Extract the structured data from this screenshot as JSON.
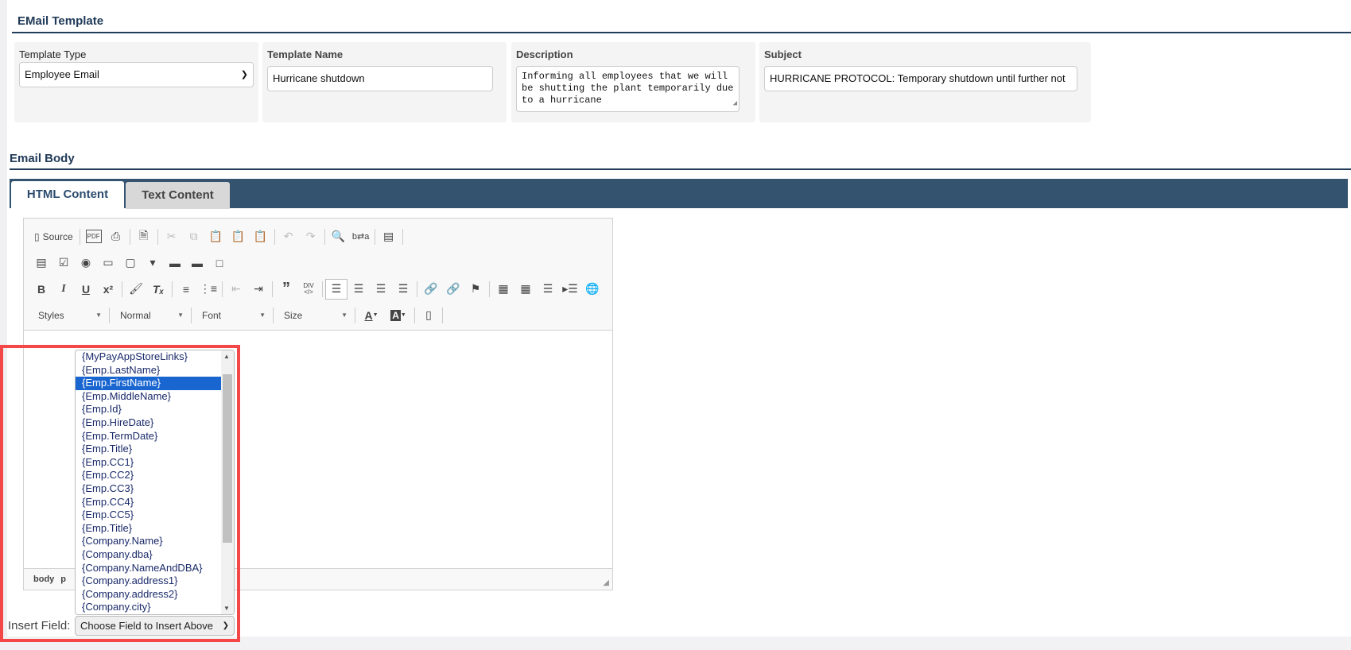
{
  "email_template": {
    "title": "EMail Template",
    "template_type": {
      "label": "Template Type",
      "value": "Employee Email"
    },
    "template_name": {
      "label": "Template Name",
      "value": "Hurricane shutdown"
    },
    "description": {
      "label": "Description",
      "value": "Informing all employees that we will be shutting the plant temporarily due to a hurricane"
    },
    "subject": {
      "label": "Subject",
      "value": "HURRICANE PROTOCOL: Temporary shutdown until further not"
    }
  },
  "email_body": {
    "title": "Email Body",
    "tabs": [
      {
        "label": "HTML Content"
      },
      {
        "label": "Text Content"
      }
    ]
  },
  "editor": {
    "source_label": "Source",
    "combos": {
      "styles": "Styles",
      "format": "Normal",
      "font": "Font",
      "size": "Size"
    },
    "path": [
      "body",
      "p"
    ]
  },
  "insert_field": {
    "label": "Insert Field:",
    "placeholder": "Choose Field to Insert Above",
    "selected": "{Emp.FirstName}",
    "options": [
      "{MyPayAppStoreLinks}",
      "{Emp.LastName}",
      "{Emp.FirstName}",
      "{Emp.MiddleName}",
      "{Emp.Id}",
      "{Emp.HireDate}",
      "{Emp.TermDate}",
      "{Emp.Title}",
      "{Emp.CC1}",
      "{Emp.CC2}",
      "{Emp.CC3}",
      "{Emp.CC4}",
      "{Emp.CC5}",
      "{Emp.Title}",
      "{Company.Name}",
      "{Company.dba}",
      "{Company.NameAndDBA}",
      "{Company.address1}",
      "{Company.address2}",
      "{Company.city}"
    ]
  },
  "colors": {
    "accent": "#34536f",
    "highlight": "#1a66d0",
    "annotation": "#f44848"
  }
}
